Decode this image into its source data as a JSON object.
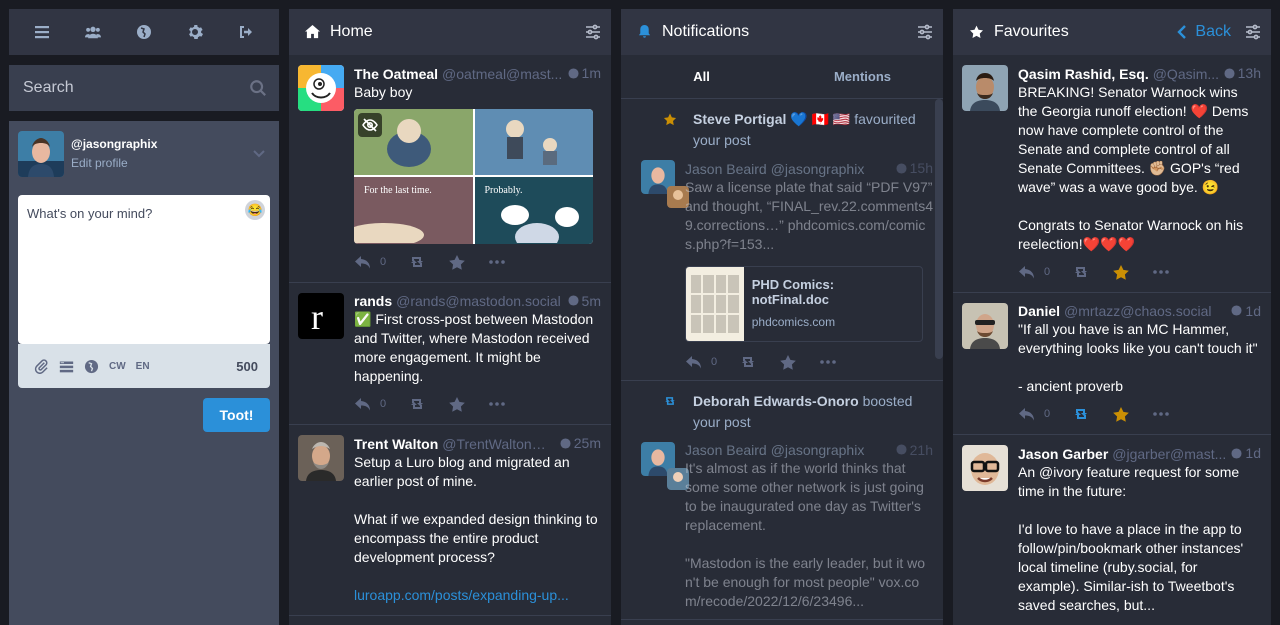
{
  "nav": {
    "icons": [
      "menu-icon",
      "people-icon",
      "globe-icon",
      "gear-icon",
      "logout-icon"
    ]
  },
  "search": {
    "placeholder": "Search"
  },
  "compose": {
    "handle": "@jasongraphix",
    "edit_profile": "Edit profile",
    "placeholder": "What's on your mind?",
    "cw": "CW",
    "lang": "EN",
    "char_count": "500",
    "toot": "Toot!"
  },
  "home": {
    "title": "Home",
    "statuses": [
      {
        "name": "The Oatmeal",
        "acct": "@oatmeal@mast...",
        "time": "1m",
        "content": [
          "Baby boy"
        ],
        "media_captions": [
          "For the last time.",
          "Probably."
        ],
        "replies": "0"
      },
      {
        "name": "rands",
        "acct": "@rands@mastodon.social",
        "time": "5m",
        "content": [
          "✅ First cross-post between Mastodon and Twitter, where Mastodon received more engagement. It might be happening."
        ],
        "replies": "0"
      },
      {
        "name": "Trent Walton",
        "acct": "@TrentWalton@...",
        "time": "25m",
        "content": [
          "Setup a Luro blog and migrated an earlier post of mine.",
          "What if we expanded design thinking to encompass the entire product development process?"
        ],
        "link": "luroapp.com/posts/expanding-up..."
      }
    ]
  },
  "notifications": {
    "title": "Notifications",
    "tabs": [
      "All",
      "Mentions"
    ],
    "items": [
      {
        "actor": "Steve Portigal 💙 🇨🇦 🇺🇸",
        "action": "favourited your post",
        "status": {
          "name": "Jason Beaird",
          "acct": "@jasongraphix",
          "time": "15h",
          "content": "Saw a license plate that said “PDF V97” and thought, “FINAL_rev.22.comments49.corrections…” phdcomics.com/comics.php?f=153...",
          "card_title": "PHD Comics: notFinal.doc",
          "card_url": "phdcomics.com",
          "replies": "0"
        }
      },
      {
        "actor": "Deborah Edwards-Onoro",
        "action": "boosted your post",
        "status": {
          "name": "Jason Beaird",
          "acct": "@jasongraphix",
          "time": "21h",
          "content1": "It's almost as if the world thinks that some some other network is just going to be inaugurated one day as Twitter's replacement.",
          "content2": "\"Mastodon is the early leader, but it won't be enough for most people\" vox.com/recode/2022/12/6/23496..."
        }
      }
    ]
  },
  "favourites": {
    "title": "Favourites",
    "back": "Back",
    "statuses": [
      {
        "name": "Qasim Rashid, Esq.",
        "acct": "@Qasim...",
        "time": "13h",
        "content": [
          "BREAKING! Senator Warnock wins the Georgia runoff election! ❤️ Dems now have complete control of the Senate and complete control of all Senate Committees. ✊🏼 GOP's “red wave” was a wave good bye. 😉",
          "Congrats to Senator Warnock on his reelection!❤️❤️❤️"
        ],
        "replies": "0"
      },
      {
        "name": "Daniel",
        "acct": "@mrtazz@chaos.social",
        "time": "1d",
        "content": [
          "\"If all you have is an MC Hammer, everything looks like you can't touch it\"",
          "- ancient proverb"
        ],
        "replies": "0"
      },
      {
        "name": "Jason Garber",
        "acct": "@jgarber@mast...",
        "time": "1d",
        "content": [
          "An @ivory feature request for some time in the future:",
          "I'd love to have a place in the app to follow/pin/bookmark other instances' local timeline (ruby.social, for example). Similar-ish to Tweetbot's saved searches, but..."
        ]
      }
    ]
  },
  "colors": {
    "accent": "#2b90d9",
    "favourite": "#ca8f04",
    "column_bg": "#282c37",
    "header_bg": "#313543"
  }
}
